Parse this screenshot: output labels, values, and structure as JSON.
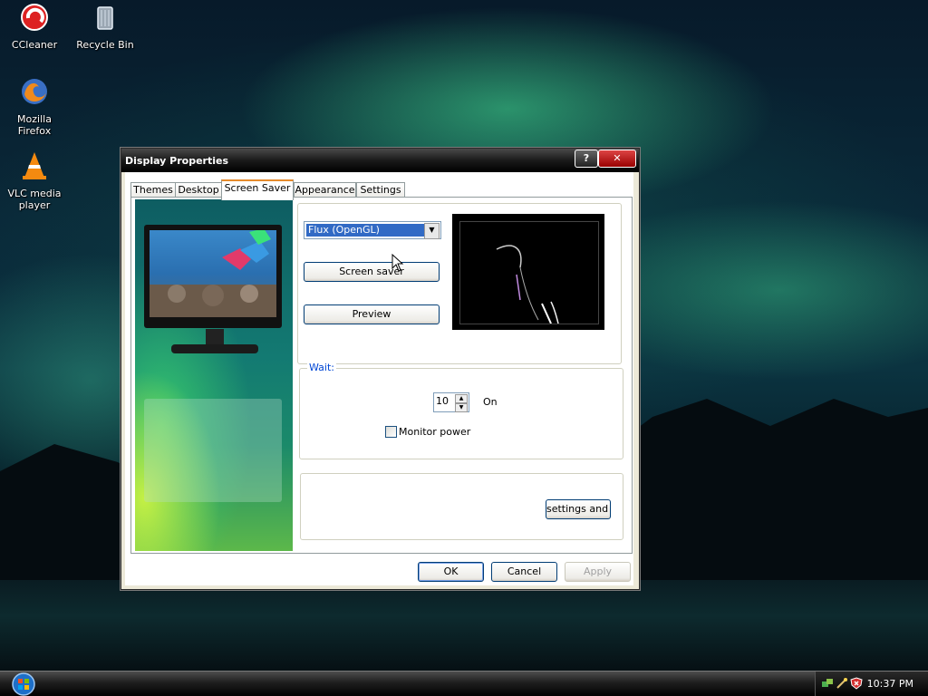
{
  "desktop": {
    "icons": [
      {
        "label": "CCleaner",
        "icon": "ccleaner-icon"
      },
      {
        "label": "Recycle Bin",
        "icon": "recycle-bin-icon"
      },
      {
        "label": "Mozilla Firefox",
        "icon": "firefox-icon"
      },
      {
        "label": "VLC media player",
        "icon": "vlc-icon"
      }
    ]
  },
  "window": {
    "title": "Display Properties",
    "help_button": "?",
    "close_button": "✕",
    "tabs": [
      {
        "label": "Themes",
        "active": false
      },
      {
        "label": "Desktop",
        "active": false
      },
      {
        "label": "Screen Saver",
        "active": true
      },
      {
        "label": "Appearance",
        "active": false
      },
      {
        "label": "Settings",
        "active": false
      }
    ],
    "screensaver": {
      "selected": "Flux (OpenGL)",
      "settings_button": "Screen saver",
      "preview_button": "Preview"
    },
    "wait": {
      "group_label": "Wait:",
      "minutes": "10",
      "on_label": "On",
      "monitor_power_label": "Monitor power",
      "monitor_power_checked": false
    },
    "power": {
      "settings_button": "settings and sa"
    },
    "buttons": {
      "ok": "OK",
      "cancel": "Cancel",
      "apply": "Apply"
    }
  },
  "taskbar": {
    "clock": "10:37 PM",
    "tray_icons": [
      "network-icon",
      "cleanup-wizard-icon",
      "security-shield-icon"
    ]
  }
}
